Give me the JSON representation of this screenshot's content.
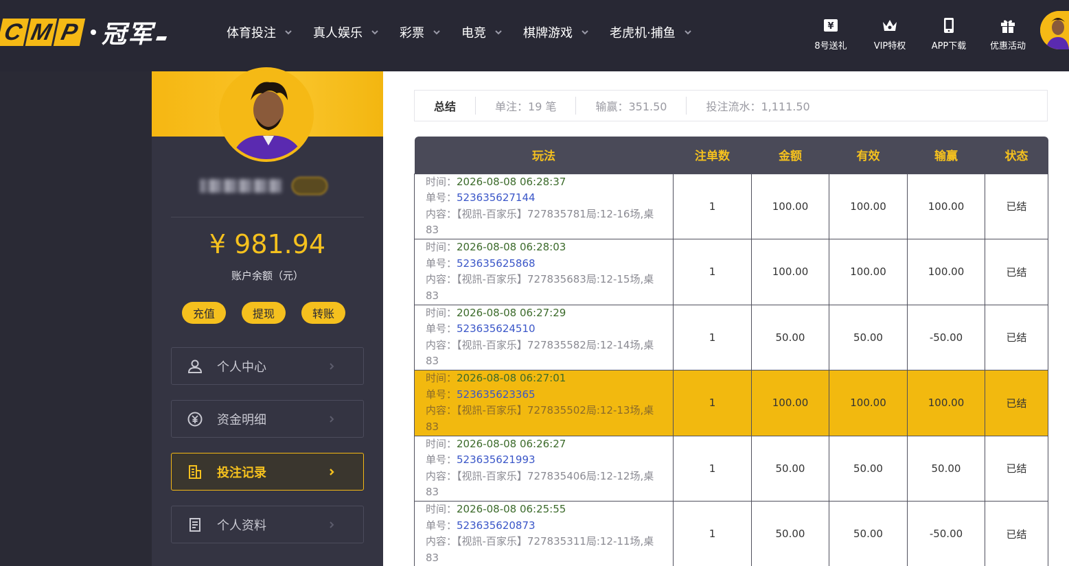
{
  "logo": {
    "letters": [
      "C",
      "M",
      "P"
    ],
    "cn": "冠军"
  },
  "nav": [
    {
      "label": "体育投注"
    },
    {
      "label": "真人娱乐"
    },
    {
      "label": "彩票"
    },
    {
      "label": "电竞"
    },
    {
      "label": "棋牌游戏"
    },
    {
      "label": "老虎机·捕鱼"
    }
  ],
  "tools": [
    {
      "label": "8号送礼",
      "icon": "gift-card-icon"
    },
    {
      "label": "VIP特权",
      "icon": "crown-icon"
    },
    {
      "label": "APP下载",
      "icon": "phone-icon"
    },
    {
      "label": "优惠活动",
      "icon": "gift-icon"
    }
  ],
  "sidebar": {
    "balance": "¥ 981.94",
    "balance_label": "账户余额（元）",
    "actions": [
      "充值",
      "提现",
      "转账"
    ],
    "menu": [
      {
        "label": "个人中心",
        "icon": "user-icon",
        "active": false
      },
      {
        "label": "资金明细",
        "icon": "currency-icon",
        "active": false
      },
      {
        "label": "投注记录",
        "icon": "bet-record-icon",
        "active": true
      },
      {
        "label": "个人资料",
        "icon": "profile-doc-icon",
        "active": false
      }
    ]
  },
  "summary": {
    "title": "总结",
    "bets": "单注：19 笔",
    "winloss": "输赢：351.50",
    "turnover": "投注流水：1,111.50"
  },
  "table": {
    "headers": [
      "玩法",
      "注单数",
      "金额",
      "有效",
      "输赢",
      "状态"
    ],
    "labels": {
      "time": "时间：",
      "no": "单号：",
      "content": "内容："
    },
    "rows": [
      {
        "time": "2026-08-08 06:28:37",
        "no": "523635627144",
        "content": "【视訊-百家乐】727835781局:12-16场,桌83",
        "count": "1",
        "amount": "100.00",
        "valid": "100.00",
        "winloss": "100.00",
        "win": true,
        "status": "已结",
        "highlight": false
      },
      {
        "time": "2026-08-08 06:28:03",
        "no": "523635625868",
        "content": "【视訊-百家乐】727835683局:12-15场,桌83",
        "count": "1",
        "amount": "100.00",
        "valid": "100.00",
        "winloss": "100.00",
        "win": true,
        "status": "已结",
        "highlight": false
      },
      {
        "time": "2026-08-08 06:27:29",
        "no": "523635624510",
        "content": "【视訊-百家乐】727835582局:12-14场,桌83",
        "count": "1",
        "amount": "50.00",
        "valid": "50.00",
        "winloss": "-50.00",
        "win": false,
        "status": "已结",
        "highlight": false
      },
      {
        "time": "2026-08-08 06:27:01",
        "no": "523635623365",
        "content": "【视訊-百家乐】727835502局:12-13场,桌83",
        "count": "1",
        "amount": "100.00",
        "valid": "100.00",
        "winloss": "100.00",
        "win": true,
        "status": "已结",
        "highlight": true
      },
      {
        "time": "2026-08-08 06:26:27",
        "no": "523635621993",
        "content": "【视訊-百家乐】727835406局:12-12场,桌83",
        "count": "1",
        "amount": "50.00",
        "valid": "50.00",
        "winloss": "50.00",
        "win": true,
        "status": "已结",
        "highlight": false
      },
      {
        "time": "2026-08-08 06:25:55",
        "no": "523635620873",
        "content": "【视訊-百家乐】727835311局:12-11场,桌83",
        "count": "1",
        "amount": "50.00",
        "valid": "50.00",
        "winloss": "-50.00",
        "win": false,
        "status": "已结",
        "highlight": false
      }
    ]
  }
}
